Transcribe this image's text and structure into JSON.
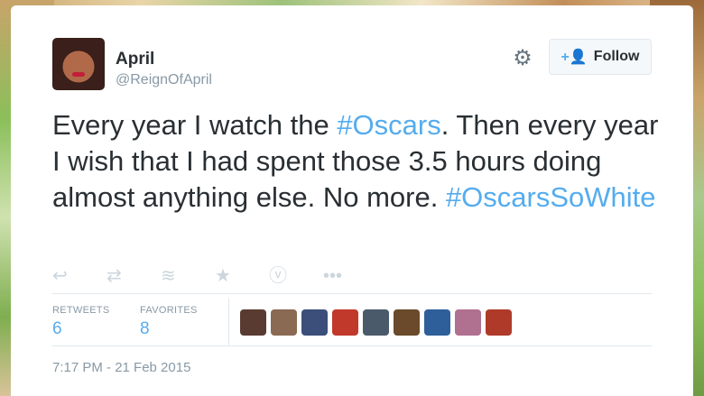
{
  "user": {
    "name": "April",
    "handle": "@ReignOfApril"
  },
  "follow_label": "Follow",
  "tweet": {
    "segments": [
      {
        "text": "Every year I watch the ",
        "type": "text"
      },
      {
        "text": "#Oscars",
        "type": "hashtag"
      },
      {
        "text": ". Then every year I wish that I had spent those 3.5 hours doing almost anything else. No more. ",
        "type": "text"
      },
      {
        "text": "#OscarsSoWhite",
        "type": "hashtag"
      }
    ]
  },
  "actions": [
    "reply-icon",
    "retweet-icon",
    "stack-icon",
    "star-icon",
    "vine-icon",
    "more-icon"
  ],
  "stats": {
    "retweets_label": "RETWEETS",
    "retweets": "6",
    "favorites_label": "FAVORITES",
    "favorites": "8"
  },
  "favoriters_colors": [
    "#5a3b32",
    "#8a6a52",
    "#3b4f7a",
    "#c0392b",
    "#4a5a6a",
    "#6a4a2a",
    "#2f5f9a",
    "#b07090",
    "#b03a2a"
  ],
  "timestamp": "7:17 PM - 21 Feb 2015",
  "colors": {
    "link": "#55acee",
    "text": "#292f33",
    "muted": "#8899a6"
  }
}
